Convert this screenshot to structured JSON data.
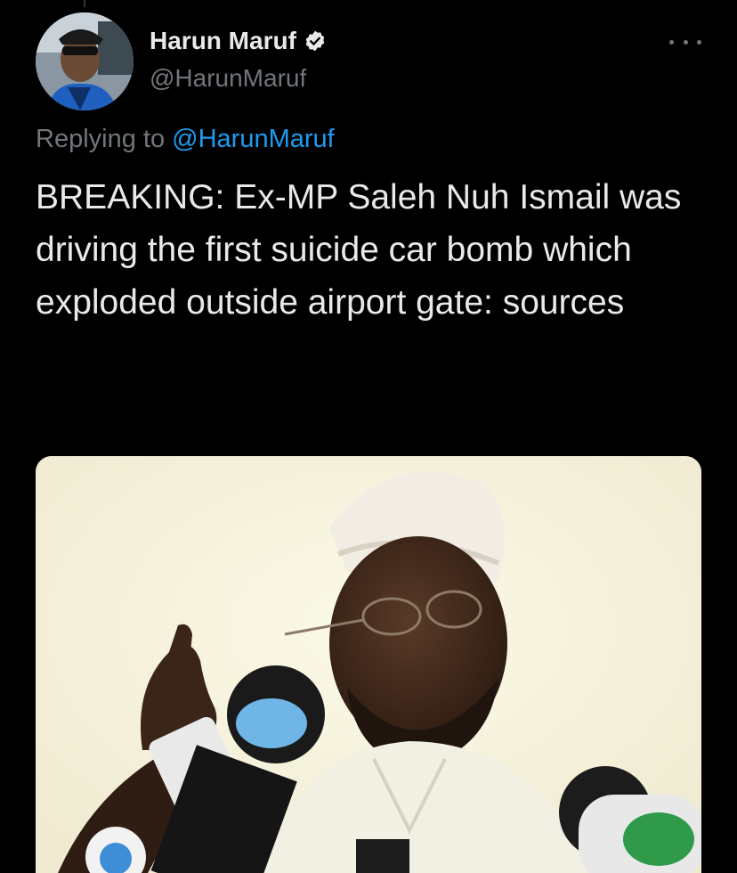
{
  "author": {
    "display_name": "Harun Maruf",
    "handle": "@HarunMaruf",
    "verified": true,
    "avatar": "avatar-photo"
  },
  "more_icon": "more-horizontal-icon",
  "reply": {
    "prefix": "Replying to ",
    "mention": "@HarunMaruf"
  },
  "tweet": {
    "text": "BREAKING: Ex-MP Saleh Nuh Ismail was driving the first suicide car bomb which exploded outside airport gate: sources"
  },
  "media": {
    "type": "photo"
  },
  "colors": {
    "background": "#000000",
    "text": "#e7e9ea",
    "secondary": "#71767b",
    "accent": "#1d9bf0"
  }
}
